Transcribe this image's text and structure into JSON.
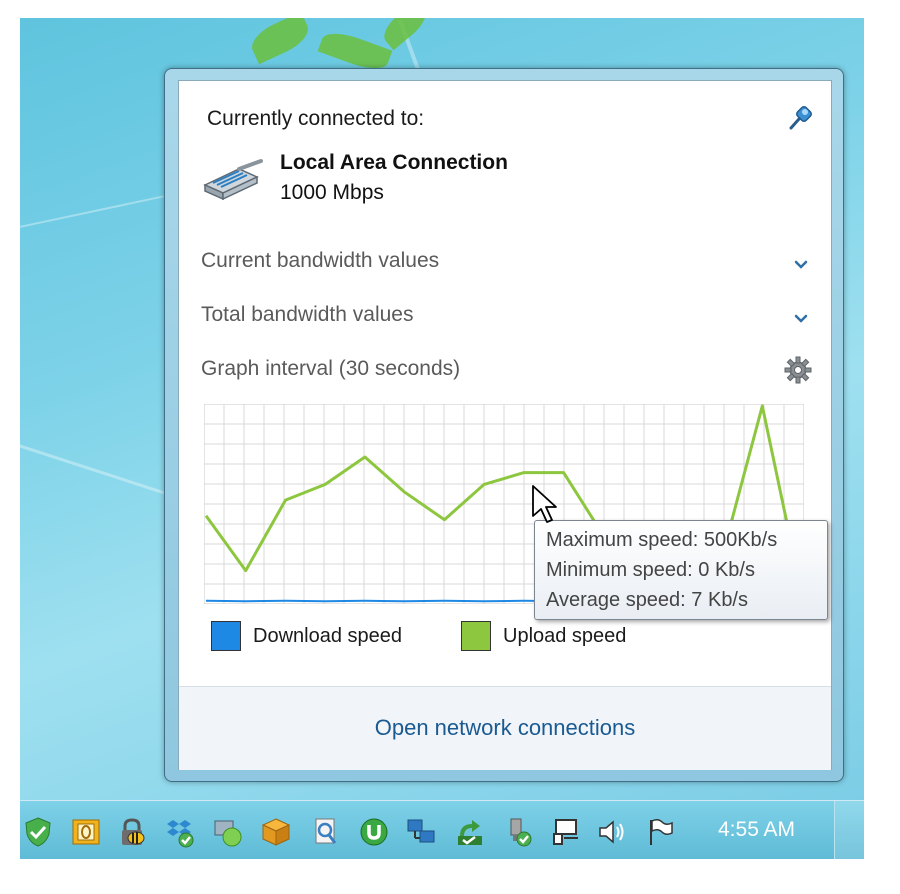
{
  "flyout": {
    "connected_label": "Currently connected to:",
    "connection_name": "Local Area Connection",
    "connection_speed": "1000 Mbps",
    "rows": {
      "current": "Current bandwidth values",
      "total": "Total bandwidth values",
      "interval": "Graph interval (30 seconds)"
    },
    "legend": {
      "download": "Download speed",
      "upload": "Upload speed"
    },
    "open_link": "Open network connections"
  },
  "tooltip": {
    "max": "Maximum speed: 500Kb/s",
    "min": "Minimum speed: 0 Kb/s",
    "avg": "Average speed: 7 Kb/s"
  },
  "taskbar": {
    "clock": "4:55 AM",
    "icons": [
      "shield-check-icon",
      "outlook-icon",
      "lock-bee-icon",
      "dropbox-icon",
      "network-meter-icon",
      "package-icon",
      "search-doc-icon",
      "utorrent-icon",
      "network-computers-icon",
      "sync-check-icon",
      "usb-check-icon",
      "tray-network-icon",
      "speaker-icon",
      "flag-icon"
    ]
  },
  "colors": {
    "download": "#1e88e5",
    "upload": "#8dc63f",
    "link": "#1a5a91"
  },
  "chart_data": {
    "type": "line",
    "title": "",
    "xlabel": "",
    "ylabel": "",
    "ylim": [
      0,
      500
    ],
    "x": [
      0,
      1,
      2,
      3,
      4,
      5,
      6,
      7,
      8,
      9,
      10,
      11,
      12,
      13,
      14,
      15
    ],
    "series": [
      {
        "name": "Upload speed",
        "values": [
          220,
          80,
          260,
          300,
          370,
          280,
          210,
          300,
          330,
          330,
          170,
          160,
          160,
          120,
          500,
          20
        ]
      },
      {
        "name": "Download speed",
        "values": [
          3,
          2,
          3,
          2,
          3,
          2,
          3,
          2,
          3,
          2,
          3,
          2,
          3,
          2,
          12,
          2
        ]
      }
    ]
  }
}
